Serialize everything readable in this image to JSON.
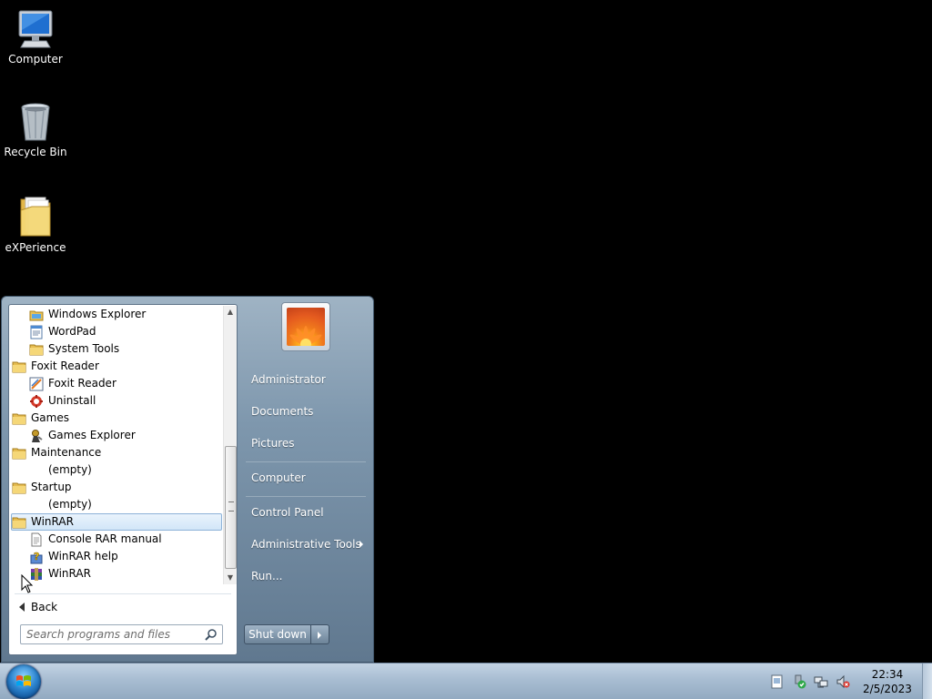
{
  "desktop": {
    "icons": [
      {
        "label": "Computer",
        "icon": "computer-icon"
      },
      {
        "label": "Recycle Bin",
        "icon": "recycle-bin-icon"
      },
      {
        "label": "eXPerience",
        "icon": "folder-icon"
      }
    ]
  },
  "start_menu": {
    "programs": [
      {
        "label": "Windows Explorer",
        "icon": "windows-explorer-icon",
        "level": 2
      },
      {
        "label": "WordPad",
        "icon": "wordpad-icon",
        "level": 2
      },
      {
        "label": "System Tools",
        "icon": "folder-icon",
        "level": 2
      },
      {
        "label": "Foxit Reader",
        "icon": "folder-icon",
        "level": 1
      },
      {
        "label": "Foxit Reader",
        "icon": "foxit-reader-icon",
        "level": 2
      },
      {
        "label": "Uninstall",
        "icon": "uninstall-icon",
        "level": 2
      },
      {
        "label": "Games",
        "icon": "folder-icon",
        "level": 1
      },
      {
        "label": "Games Explorer",
        "icon": "games-explorer-icon",
        "level": 2
      },
      {
        "label": "Maintenance",
        "icon": "folder-icon",
        "level": 1
      },
      {
        "label": "(empty)",
        "icon": "",
        "level": 2
      },
      {
        "label": "Startup",
        "icon": "folder-icon",
        "level": 1
      },
      {
        "label": "(empty)",
        "icon": "",
        "level": 2
      },
      {
        "label": "WinRAR",
        "icon": "folder-icon",
        "level": 1,
        "selected": true
      },
      {
        "label": "Console RAR manual",
        "icon": "text-document-icon",
        "level": 2
      },
      {
        "label": "WinRAR help",
        "icon": "help-icon",
        "level": 2
      },
      {
        "label": "WinRAR",
        "icon": "winrar-icon",
        "level": 2
      }
    ],
    "back_label": "Back",
    "search_placeholder": "Search programs and files",
    "right_items": {
      "administrator": "Administrator",
      "documents": "Documents",
      "pictures": "Pictures",
      "computer": "Computer",
      "control_panel": "Control Panel",
      "administrative_tools": "Administrative Tools",
      "run": "Run..."
    },
    "shutdown_label": "Shut down"
  },
  "taskbar": {
    "time": "22:34",
    "date": "2/5/2023",
    "tray_icons": [
      "action-center-icon",
      "safely-remove-hardware-icon",
      "network-icon",
      "volume-muted-icon"
    ]
  },
  "colors": {
    "desktop_bg": "#000000",
    "selection_border": "#8db2d8",
    "taskbar": "#a8bdd2"
  }
}
